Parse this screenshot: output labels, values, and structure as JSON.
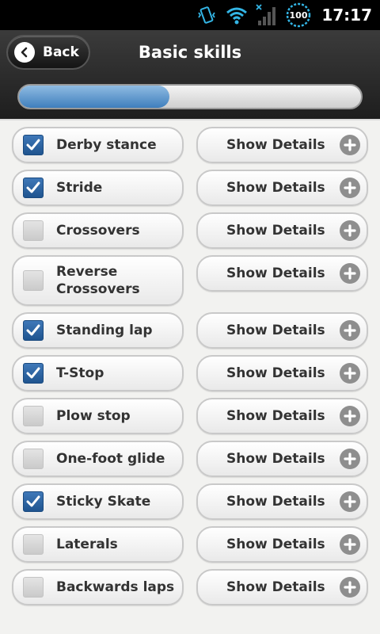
{
  "status_bar": {
    "battery": "100",
    "time": "17:17"
  },
  "header": {
    "back_label": "Back",
    "title": "Basic skills"
  },
  "progress": {
    "fraction": 0.44,
    "fill_color": "#3f7fbd"
  },
  "colors": {
    "checkbox_checked": "#2a63a3",
    "checkbox_unchecked": "#d4d4d4",
    "plus_icon": "#8e8e8e"
  },
  "details_label": "Show Details",
  "skills": [
    {
      "label": "Derby stance",
      "checked": true
    },
    {
      "label": "Stride",
      "checked": true
    },
    {
      "label": "Crossovers",
      "checked": false
    },
    {
      "label": "Reverse\nCrossovers",
      "checked": false
    },
    {
      "label": "Standing lap",
      "checked": true
    },
    {
      "label": "T-Stop",
      "checked": true
    },
    {
      "label": "Plow stop",
      "checked": false
    },
    {
      "label": "One-foot glide",
      "checked": false
    },
    {
      "label": "Sticky Skate",
      "checked": true
    },
    {
      "label": "Laterals",
      "checked": false
    },
    {
      "label": "Backwards laps",
      "checked": false
    }
  ]
}
